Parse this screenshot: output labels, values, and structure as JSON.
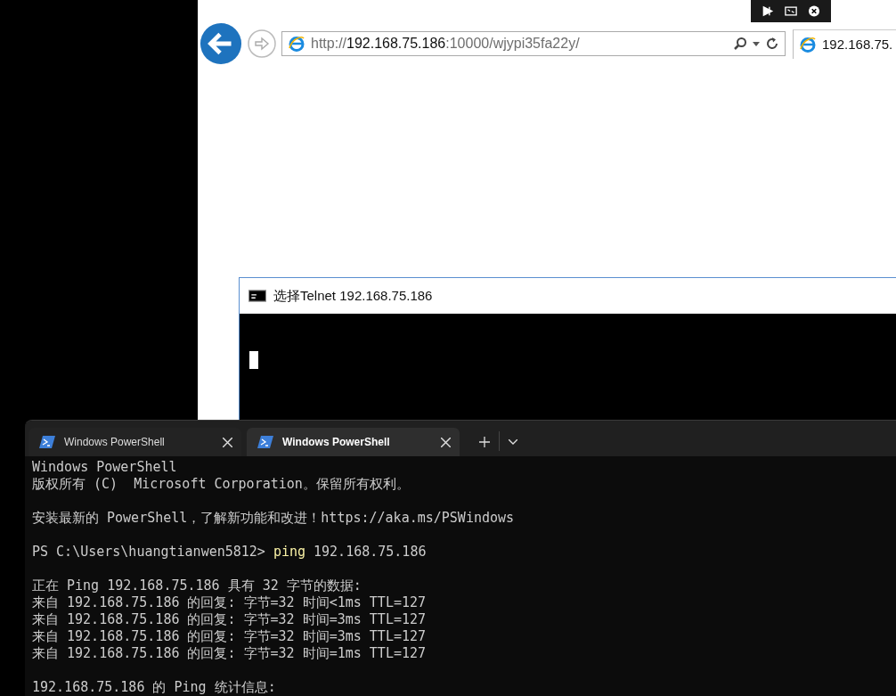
{
  "browser": {
    "address": "http://**192.168.75.186**:10000/wjypi35fa22y/",
    "tab_title": "192.168.75."
  },
  "telnet_window": {
    "title": "选择Telnet 192.168.75.186"
  },
  "terminal": {
    "tabs": [
      {
        "label": "Windows PowerShell",
        "selected": false
      },
      {
        "label": "Windows PowerShell",
        "selected": true
      }
    ],
    "lines": [
      {
        "kind": "text",
        "text": "Windows PowerShell"
      },
      {
        "kind": "text",
        "text": "版权所有 (C)  Microsoft Corporation。保留所有权利。"
      },
      {
        "kind": "blank"
      },
      {
        "kind": "text",
        "text": "安装最新的 PowerShell，了解新功能和改进！https://aka.ms/PSWindows"
      },
      {
        "kind": "blank"
      },
      {
        "kind": "prompt",
        "prompt": "PS C:\\Users\\huangtianwen5812>",
        "command": "ping",
        "args": "192.168.75.186"
      },
      {
        "kind": "blank"
      },
      {
        "kind": "text",
        "text": "正在 Ping 192.168.75.186 具有 32 字节的数据:"
      },
      {
        "kind": "text",
        "text": "来自 192.168.75.186 的回复: 字节=32 时间<1ms TTL=127"
      },
      {
        "kind": "text",
        "text": "来自 192.168.75.186 的回复: 字节=32 时间=3ms TTL=127"
      },
      {
        "kind": "text",
        "text": "来自 192.168.75.186 的回复: 字节=32 时间=3ms TTL=127"
      },
      {
        "kind": "text",
        "text": "来自 192.168.75.186 的回复: 字节=32 时间=1ms TTL=127"
      },
      {
        "kind": "blank"
      },
      {
        "kind": "text",
        "text": "192.168.75.186 的 Ping 统计信息:"
      }
    ]
  }
}
